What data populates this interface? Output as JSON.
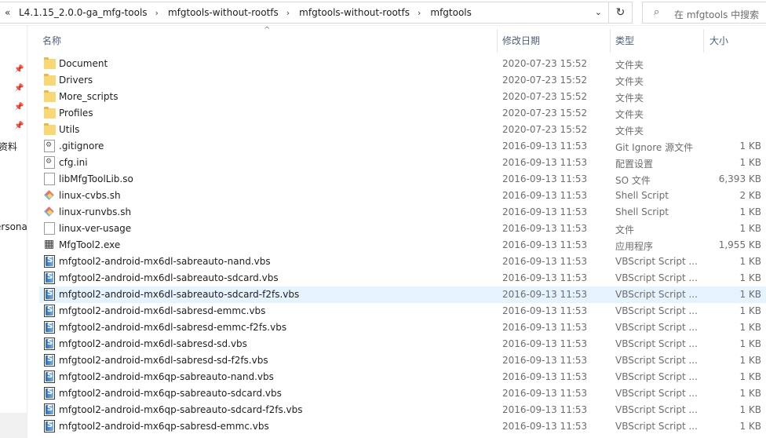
{
  "address_bar": {
    "overflow_glyph": "«",
    "crumbs": [
      "L4.1.15_2.0.0-ga_mfg-tools",
      "mfgtools-without-rootfs",
      "mfgtools-without-rootfs",
      "mfgtools"
    ],
    "separator": "›",
    "dropdown_glyph": "⌄",
    "refresh_glyph": "↻"
  },
  "search": {
    "icon_glyph": "⌕",
    "placeholder": "在 mfgtools 中搜索"
  },
  "nav_pane": {
    "labels": [
      "资料",
      "ersona"
    ]
  },
  "columns": {
    "name": "名称",
    "date": "修改日期",
    "type": "类型",
    "size": "大小",
    "sort_glyph": "^"
  },
  "files": [
    {
      "name": "Document",
      "date": "2020-07-23 15:52",
      "type": "文件夹",
      "size": "",
      "icon": "folder"
    },
    {
      "name": "Drivers",
      "date": "2020-07-23 15:52",
      "type": "文件夹",
      "size": "",
      "icon": "folder"
    },
    {
      "name": "More_scripts",
      "date": "2020-07-23 15:52",
      "type": "文件夹",
      "size": "",
      "icon": "folder"
    },
    {
      "name": "Profiles",
      "date": "2020-07-23 15:52",
      "type": "文件夹",
      "size": "",
      "icon": "folder"
    },
    {
      "name": "Utils",
      "date": "2020-07-23 15:52",
      "type": "文件夹",
      "size": "",
      "icon": "folder"
    },
    {
      "name": ".gitignore",
      "date": "2016-09-13 11:53",
      "type": "Git Ignore 源文件",
      "size": "1 KB",
      "icon": "gear-file"
    },
    {
      "name": "cfg.ini",
      "date": "2016-09-13 11:53",
      "type": "配置设置",
      "size": "1 KB",
      "icon": "gear-file"
    },
    {
      "name": "libMfgToolLib.so",
      "date": "2016-09-13 11:53",
      "type": "SO 文件",
      "size": "6,393 KB",
      "icon": "file"
    },
    {
      "name": "linux-cvbs.sh",
      "date": "2016-09-13 11:53",
      "type": "Shell Script",
      "size": "2 KB",
      "icon": "shell-script"
    },
    {
      "name": "linux-runvbs.sh",
      "date": "2016-09-13 11:53",
      "type": "Shell Script",
      "size": "1 KB",
      "icon": "shell-script"
    },
    {
      "name": "linux-ver-usage",
      "date": "2016-09-13 11:53",
      "type": "文件",
      "size": "1 KB",
      "icon": "file"
    },
    {
      "name": "MfgTool2.exe",
      "date": "2016-09-13 11:53",
      "type": "应用程序",
      "size": "1,955 KB",
      "icon": "exe"
    },
    {
      "name": "mfgtool2-android-mx6dl-sabreauto-nand.vbs",
      "date": "2016-09-13 11:53",
      "type": "VBScript Script ...",
      "size": "1 KB",
      "icon": "vbs"
    },
    {
      "name": "mfgtool2-android-mx6dl-sabreauto-sdcard.vbs",
      "date": "2016-09-13 11:53",
      "type": "VBScript Script ...",
      "size": "1 KB",
      "icon": "vbs"
    },
    {
      "name": "mfgtool2-android-mx6dl-sabreauto-sdcard-f2fs.vbs",
      "date": "2016-09-13 11:53",
      "type": "VBScript Script ...",
      "size": "1 KB",
      "icon": "vbs",
      "selected": true
    },
    {
      "name": "mfgtool2-android-mx6dl-sabresd-emmc.vbs",
      "date": "2016-09-13 11:53",
      "type": "VBScript Script ...",
      "size": "1 KB",
      "icon": "vbs"
    },
    {
      "name": "mfgtool2-android-mx6dl-sabresd-emmc-f2fs.vbs",
      "date": "2016-09-13 11:53",
      "type": "VBScript Script ...",
      "size": "1 KB",
      "icon": "vbs"
    },
    {
      "name": "mfgtool2-android-mx6dl-sabresd-sd.vbs",
      "date": "2016-09-13 11:53",
      "type": "VBScript Script ...",
      "size": "1 KB",
      "icon": "vbs"
    },
    {
      "name": "mfgtool2-android-mx6dl-sabresd-sd-f2fs.vbs",
      "date": "2016-09-13 11:53",
      "type": "VBScript Script ...",
      "size": "1 KB",
      "icon": "vbs"
    },
    {
      "name": "mfgtool2-android-mx6qp-sabreauto-nand.vbs",
      "date": "2016-09-13 11:53",
      "type": "VBScript Script ...",
      "size": "1 KB",
      "icon": "vbs"
    },
    {
      "name": "mfgtool2-android-mx6qp-sabreauto-sdcard.vbs",
      "date": "2016-09-13 11:53",
      "type": "VBScript Script ...",
      "size": "1 KB",
      "icon": "vbs"
    },
    {
      "name": "mfgtool2-android-mx6qp-sabreauto-sdcard-f2fs.vbs",
      "date": "2016-09-13 11:53",
      "type": "VBScript Script ...",
      "size": "1 KB",
      "icon": "vbs"
    },
    {
      "name": "mfgtool2-android-mx6qp-sabresd-emmc.vbs",
      "date": "2016-09-13 11:53",
      "type": "VBScript Script ...",
      "size": "1 KB",
      "icon": "vbs"
    }
  ]
}
